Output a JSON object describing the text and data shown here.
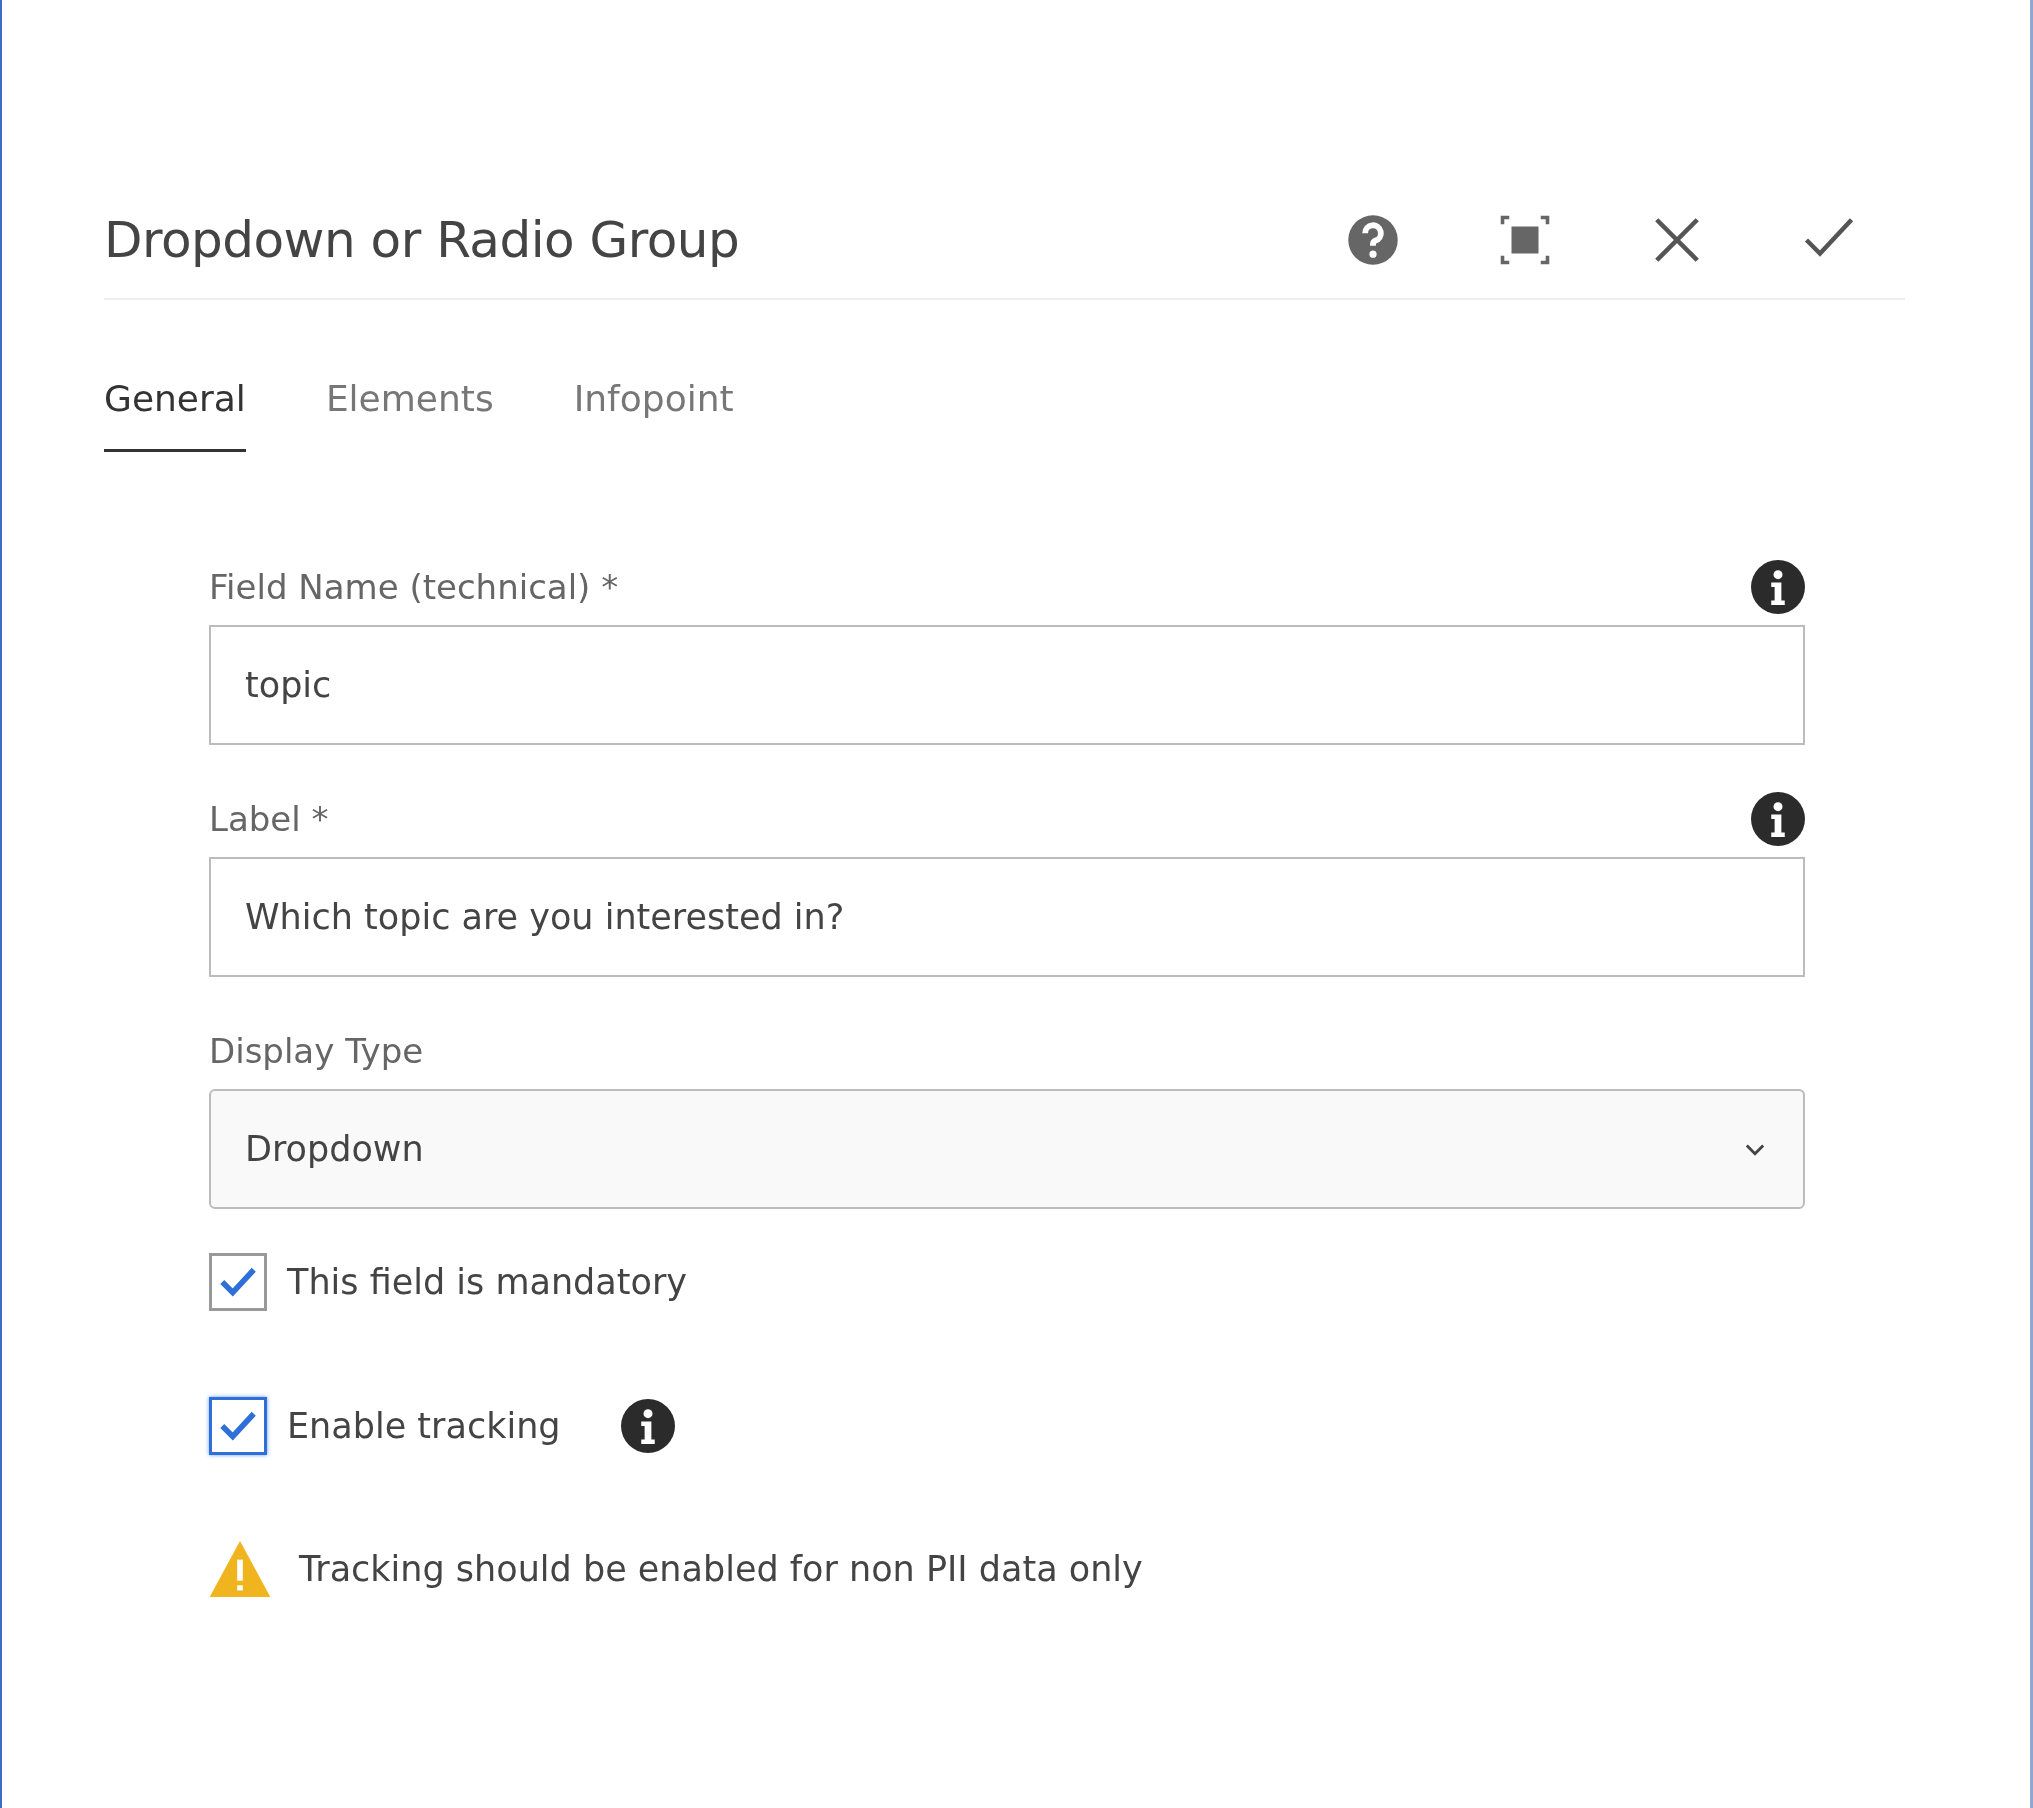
{
  "dialog": {
    "title": "Dropdown or Radio Group"
  },
  "toolbar": [
    {
      "kind": "help"
    },
    {
      "kind": "fullscreen"
    },
    {
      "kind": "close"
    },
    {
      "kind": "confirm"
    }
  ],
  "tabs": [
    {
      "label": "General",
      "selected": true
    },
    {
      "label": "Elements",
      "selected": false
    },
    {
      "label": "Infopoint",
      "selected": false
    }
  ],
  "fields": [
    {
      "kind": "text",
      "label": "Field Name (technical) *",
      "value": "topic",
      "info": true
    },
    {
      "kind": "text",
      "label": "Label *",
      "value": "Which topic are you interested in?",
      "info": true
    },
    {
      "kind": "select",
      "label": "Display Type",
      "value": "Dropdown",
      "info": false
    }
  ],
  "checkboxes": [
    {
      "label": "This field is mandatory",
      "checked": true,
      "focused": false,
      "info": false
    },
    {
      "label": "Enable tracking",
      "checked": true,
      "focused": true,
      "info": true
    }
  ],
  "warning": {
    "text": "Tracking should be enabled for non PII data only"
  }
}
